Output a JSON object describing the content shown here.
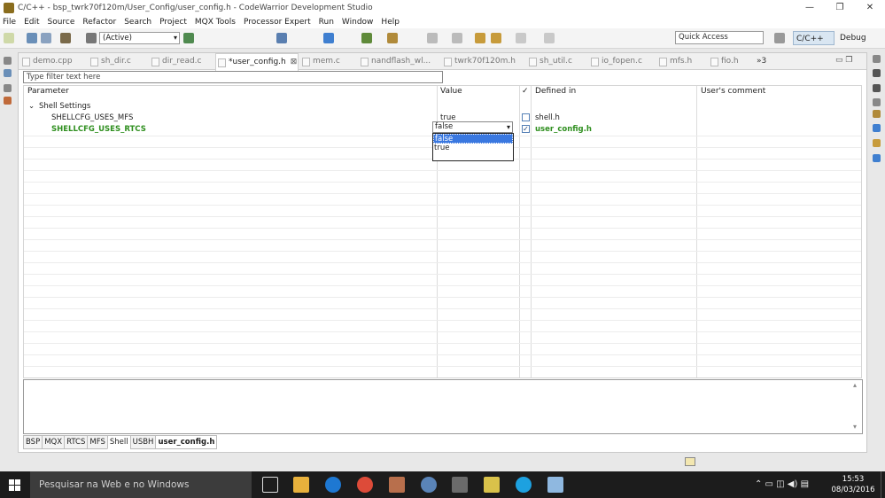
{
  "window": {
    "title": "C/C++ - bsp_twrk70f120m/User_Config/user_config.h - CodeWarrior Development Studio",
    "controls": [
      "—",
      "❐",
      "✕"
    ]
  },
  "menu": [
    "File",
    "Edit",
    "Source",
    "Refactor",
    "Search",
    "Project",
    "MQX Tools",
    "Processor Expert",
    "Run",
    "Window",
    "Help"
  ],
  "toolbar": {
    "build_config": "(Active)",
    "quick_access_placeholder": "Quick Access",
    "perspective_active": "C/C++",
    "perspective_other": "Debug"
  },
  "editor_tabs": [
    {
      "label": "demo.cpp",
      "active": false
    },
    {
      "label": "sh_dir.c",
      "active": false
    },
    {
      "label": "dir_read.c",
      "active": false
    },
    {
      "label": "*user_config.h",
      "active": true
    },
    {
      "label": "mem.c",
      "active": false
    },
    {
      "label": "nandflash_wl...",
      "active": false
    },
    {
      "label": "twrk70f120m.h",
      "active": false
    },
    {
      "label": "sh_util.c",
      "active": false
    },
    {
      "label": "io_fopen.c",
      "active": false
    },
    {
      "label": "mfs.h",
      "active": false
    },
    {
      "label": "fio.h",
      "active": false
    }
  ],
  "tab_overflow": "»3",
  "tab_close_glyph": "⊠",
  "filter_placeholder": "Type filter text here",
  "columns": {
    "parameter": "Parameter",
    "value": "Value",
    "check": "✓",
    "defined_in": "Defined in",
    "comment": "User's comment"
  },
  "group": {
    "toggle": "⌄",
    "label": "Shell Settings"
  },
  "rows": [
    {
      "parameter": "SHELLCFG_USES_MFS",
      "value": "true",
      "checked": false,
      "defined_in": "shell.h",
      "modified": false
    },
    {
      "parameter": "SHELLCFG_USES_RTCS",
      "value": "false",
      "checked": true,
      "defined_in": "user_config.h",
      "modified": true
    }
  ],
  "value_dropdown": {
    "options": [
      "false",
      "true"
    ],
    "selected": "false"
  },
  "bottom_tabs": [
    "BSP",
    "MQX",
    "RTCS",
    "MFS",
    "Shell",
    "USBH",
    "user_config.h"
  ],
  "active_bottom_tab": "Shell",
  "taskbar": {
    "search_placeholder": "Pesquisar na Web e no Windows",
    "time": "15:53",
    "date": "08/03/2016"
  },
  "colors": {
    "modified_text": "#2f8f1f",
    "selection": "#3a78e0",
    "taskbar": "#1c1c1c"
  }
}
